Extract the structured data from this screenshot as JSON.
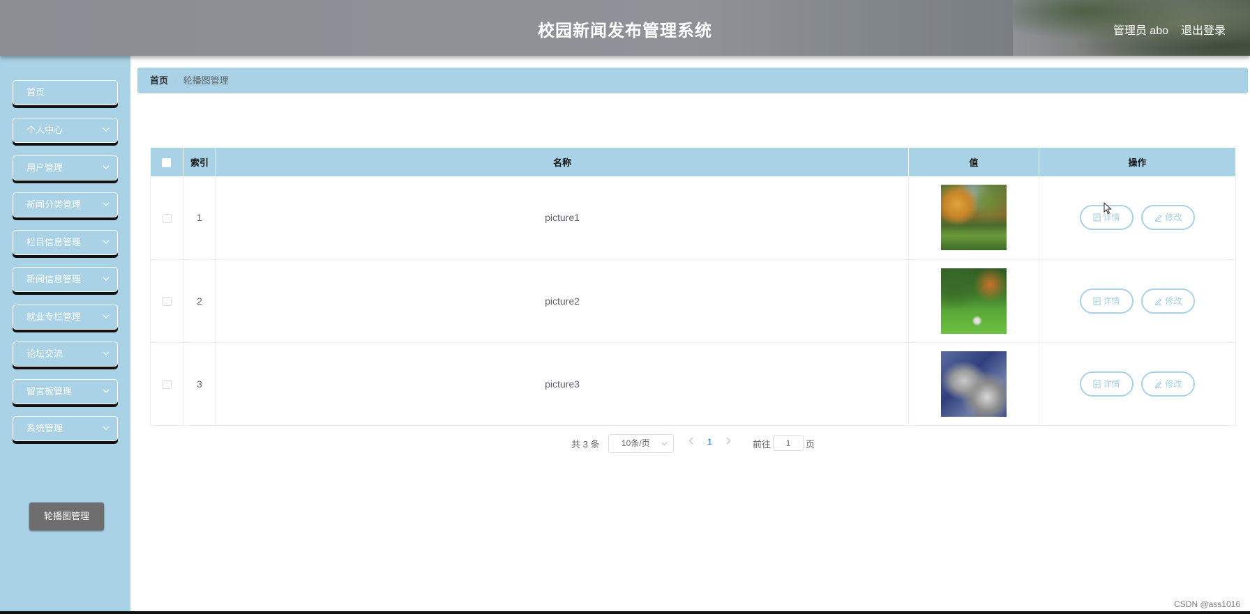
{
  "header": {
    "title": "校园新闻发布管理系统",
    "user": "管理员 abo",
    "logout": "退出登录"
  },
  "sidebar": {
    "items": [
      {
        "label": "首页"
      },
      {
        "label": "个人中心"
      },
      {
        "label": "用户管理"
      },
      {
        "label": "新闻分类管理"
      },
      {
        "label": "栏目信息管理"
      },
      {
        "label": "新闻信息管理"
      },
      {
        "label": "就业专栏管理"
      },
      {
        "label": "论坛交流"
      },
      {
        "label": "留言板管理"
      },
      {
        "label": "系统管理"
      }
    ],
    "submenu": {
      "label": "轮播图管理"
    }
  },
  "breadcrumb": {
    "home": "首页",
    "separator": "/",
    "current": "轮播图管理"
  },
  "table": {
    "headers": {
      "index": "索引",
      "name": "名称",
      "value": "值",
      "actions": "操作"
    },
    "rows": [
      {
        "index": "1",
        "name": "picture1"
      },
      {
        "index": "2",
        "name": "picture2"
      },
      {
        "index": "3",
        "name": "picture3"
      }
    ],
    "detail_label": "详情",
    "edit_label": "修改"
  },
  "pagination": {
    "total": "共 3 条",
    "page_size": "10条/页",
    "current_page": "1",
    "goto_label": "前往",
    "goto_value": "1",
    "page_unit": "页"
  },
  "watermark": "CSDN @ass1016",
  "colors": {
    "accent": "#a9d2e6",
    "header": "#8f9398",
    "submenu_active": "#6e6e6e",
    "link": "#409eff"
  }
}
